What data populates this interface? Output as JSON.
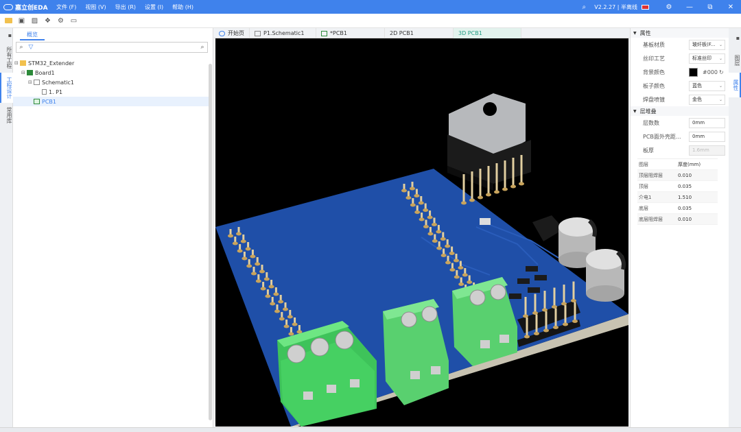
{
  "app": {
    "logo_text": "嘉立创EDA",
    "version": "V2.2.27 | 半离线"
  },
  "menu": [
    "文件 (F)",
    "视图 (V)",
    "导出 (R)",
    "设置 (I)",
    "帮助 (H)"
  ],
  "left_tabs": [
    "所有工程",
    "工程设计",
    "常用库"
  ],
  "project": {
    "tab_label": "概览",
    "search_placeholder": "",
    "tree": [
      {
        "label": "STM32_Extender",
        "icon": "folder-icon"
      },
      {
        "label": "Board1",
        "icon": "board-icon"
      },
      {
        "label": "Schematic1",
        "icon": "schematic-icon"
      },
      {
        "label": "1. P1",
        "icon": "page-icon"
      },
      {
        "label": "PCB1",
        "icon": "pcb-icon"
      }
    ]
  },
  "doc_tabs": [
    {
      "label": "开始页"
    },
    {
      "label": "P1.Schematic1"
    },
    {
      "label": "*PCB1"
    },
    {
      "label": "2D  PCB1"
    },
    {
      "label": "3D  PCB1"
    }
  ],
  "properties": {
    "section_title": "属性",
    "rows": [
      {
        "label": "基板材质",
        "value": "玻纤板(F..."
      },
      {
        "label": "丝印工艺",
        "value": "标准丝印"
      },
      {
        "label": "背景颜色",
        "value": "#000"
      },
      {
        "label": "板子颜色",
        "value": "蓝色"
      },
      {
        "label": "焊盘喷镀",
        "value": "金色"
      }
    ]
  },
  "stackup": {
    "section_title": "层堆叠",
    "rows": [
      {
        "label": "层数数",
        "value": "0mm"
      },
      {
        "label": "PCB面外壳距...",
        "value": "0mm"
      },
      {
        "label": "板厚",
        "value": "1.6mm"
      }
    ],
    "table_header": [
      "图层",
      "厚度(mm)"
    ],
    "table": [
      [
        "顶层阻焊层",
        "0.010"
      ],
      [
        "顶层",
        "0.035"
      ],
      [
        "介电1",
        "1.510"
      ],
      [
        "底层",
        "0.035"
      ],
      [
        "底层阻焊层",
        "0.010"
      ]
    ]
  },
  "right_tabs": [
    "图层",
    "属性"
  ],
  "colors": {
    "accent": "#3f82ec",
    "pcb_blue": "#1f4fa8",
    "terminal_green": "#4fd16a",
    "active_tab": "#1e9c82"
  }
}
